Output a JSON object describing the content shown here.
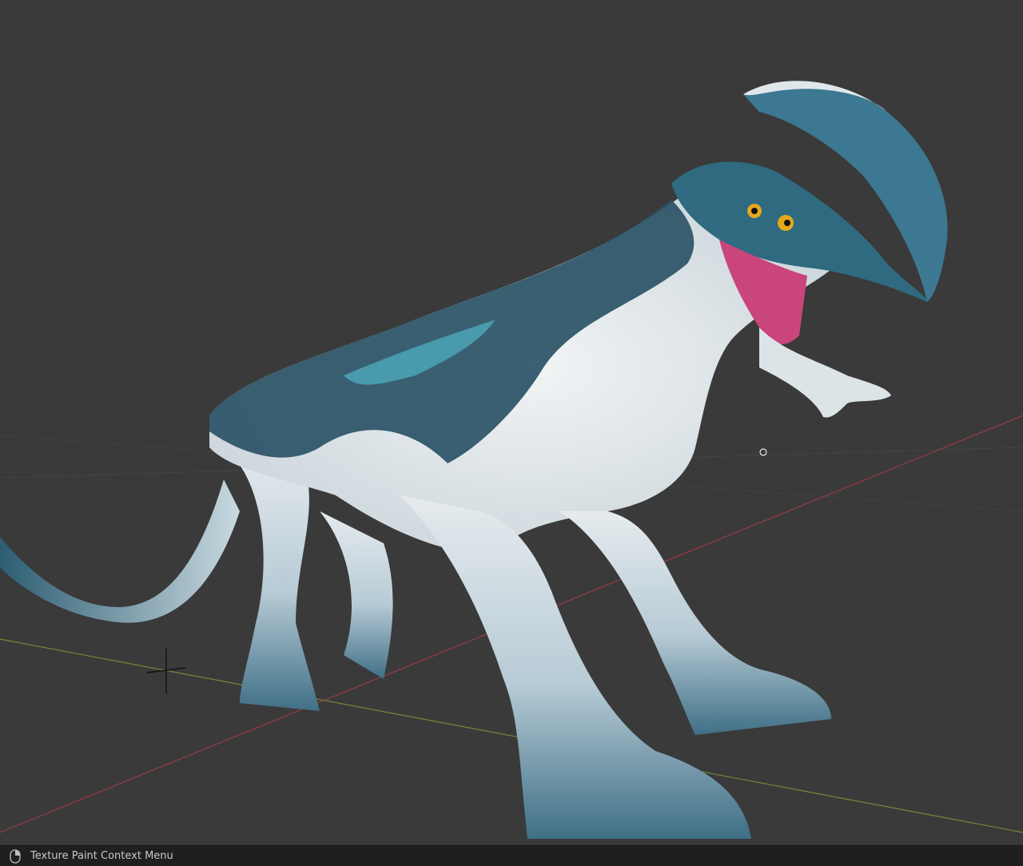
{
  "viewport": {
    "background_color": "#3a3a3a",
    "x_axis_color": "#9a3a44",
    "y_axis_color": "#6f8a3a",
    "model": "creature-model",
    "cursor": "brush-circle-cursor",
    "origin": "3d-cursor-icon"
  },
  "statusbar": {
    "mouse_icon": "mouse-right-click-icon",
    "context_text": "Texture Paint Context Menu"
  }
}
